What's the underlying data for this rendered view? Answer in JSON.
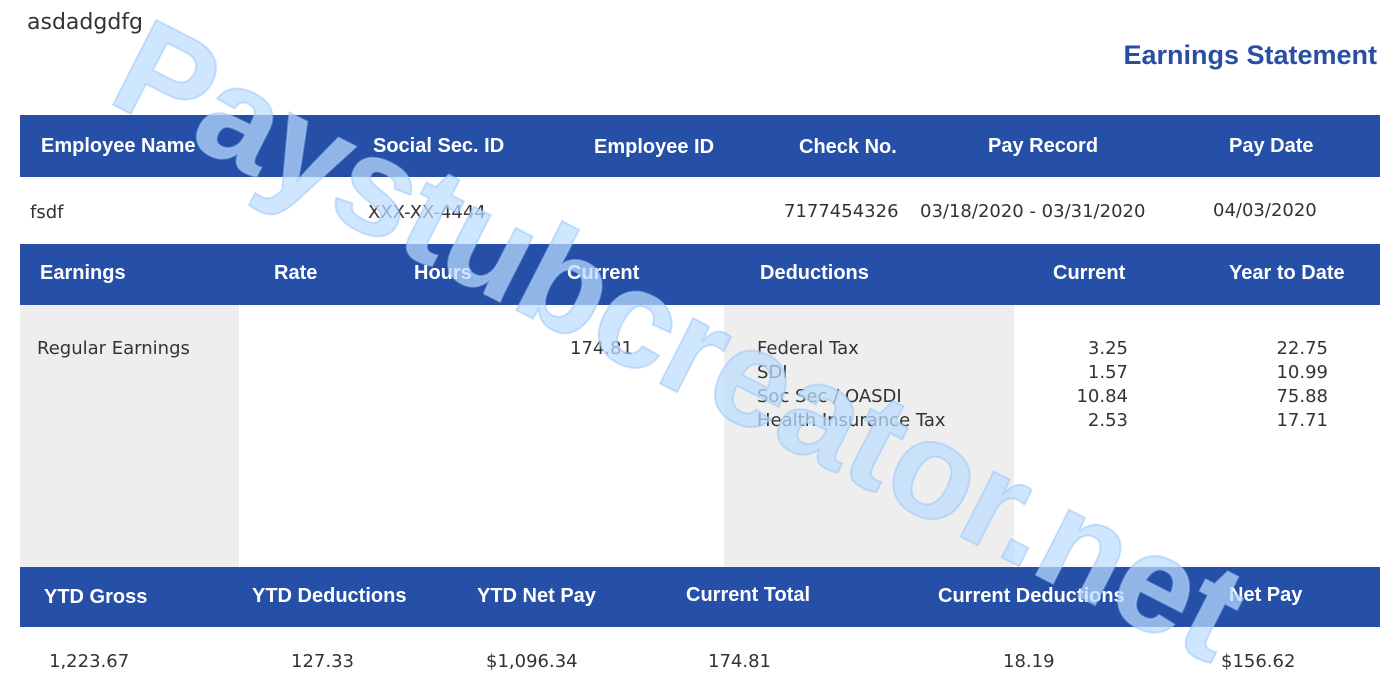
{
  "company_name": "asdadgdfg",
  "title": "Earnings Statement",
  "employee_header": {
    "name": "Employee Name",
    "ssn": "Social Sec. ID",
    "emp_id": "Employee ID",
    "check_no": "Check No.",
    "pay_record": "Pay Record",
    "pay_date": "Pay Date"
  },
  "employee": {
    "name": "fsdf",
    "ssn": "XXX-XX-4444",
    "emp_id": "",
    "check_no": "7177454326",
    "pay_record": "03/18/2020 - 03/31/2020",
    "pay_date": "04/03/2020"
  },
  "earnings_header": {
    "earnings": "Earnings",
    "rate": "Rate",
    "hours": "Hours",
    "current": "Current",
    "deductions": "Deductions",
    "ded_current": "Current",
    "ytd": "Year to Date"
  },
  "earnings": [
    {
      "label": "Regular Earnings",
      "rate": "",
      "hours": "",
      "current": "174.81"
    }
  ],
  "deductions": [
    {
      "label": "Federal Tax",
      "current": "3.25",
      "ytd": "22.75"
    },
    {
      "label": "SDI",
      "current": "1.57",
      "ytd": "10.99"
    },
    {
      "label": "Soc Sec / OASDI",
      "current": "10.84",
      "ytd": "75.88"
    },
    {
      "label": "Health Insurance Tax",
      "current": "2.53",
      "ytd": "17.71"
    }
  ],
  "totals_header": {
    "ytd_gross": "YTD Gross",
    "ytd_deductions": "YTD Deductions",
    "ytd_net": "YTD Net Pay",
    "current_total": "Current Total",
    "current_deductions": "Current Deductions",
    "net_pay": "Net Pay"
  },
  "totals": {
    "ytd_gross": "1,223.67",
    "ytd_deductions": "127.33",
    "ytd_net": "$1,096.34",
    "current_total": "174.81",
    "current_deductions": "18.19",
    "net_pay": "$156.62"
  },
  "watermark": "Paystubcreator.net",
  "colors": {
    "accent": "#2650a8",
    "title": "#2a4ea3",
    "shade": "#eeeeee",
    "watermark": "#bcdcff"
  }
}
